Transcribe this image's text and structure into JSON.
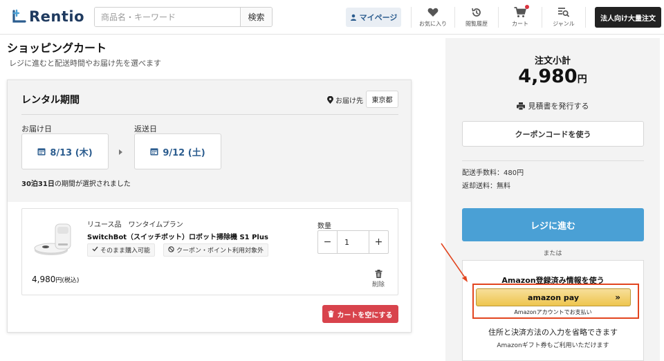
{
  "header": {
    "logo_text": "Rentio",
    "search_placeholder": "商品名・キーワード",
    "search_button": "検索",
    "mypage_label": "マイページ",
    "nav": [
      {
        "icon": "heart-icon",
        "label": "お気に入り"
      },
      {
        "icon": "history-icon",
        "label": "閲覧履歴"
      },
      {
        "icon": "cart-icon",
        "label": "カート"
      },
      {
        "icon": "genre-icon",
        "label": "ジャンル"
      }
    ],
    "corporate_button": "法人向け大量注文"
  },
  "page": {
    "title": "ショッピングカート",
    "subtitle": "レジに進むと配送時間やお届け先を選べます"
  },
  "rental": {
    "title": "レンタル期間",
    "destination_label": "お届け先",
    "destination_value": "東京都",
    "delivery_label": "お届け日",
    "delivery_date": "8/13 (木)",
    "return_label": "返送日",
    "return_date": "9/12 (土)",
    "period_bold": "30泊31日",
    "period_rest": "の期間が選択されました"
  },
  "product": {
    "condition": "リユース品　ワンタイムプラン",
    "name": "SwitchBot（スイッチボット）ロボット掃除機 S1 Plus",
    "chip_buy": "そのまま購入可能",
    "chip_coupon": "クーポン・ポイント利用対象外",
    "qty_label": "数量",
    "qty_value": "1",
    "qty_minus": "−",
    "qty_plus": "+",
    "price": "4,980",
    "price_suffix": "円(税込)",
    "delete_label": "削除"
  },
  "cart": {
    "empty_button": "カートを空にする"
  },
  "summary": {
    "title": "注文小計",
    "total": "4,980",
    "total_unit": "円",
    "estimate_label": "見積書を発行する",
    "coupon_button": "クーポンコードを使う",
    "shipping_fee": "配送手数料：480円",
    "return_fee": "返却送料：無料",
    "checkout_button": "レジに進む",
    "or_text": "または",
    "amazon_title": "Amazon登録済み情報を使う",
    "amazon_pay_label": "amazon pay",
    "amazon_chevron": "»",
    "amazon_caption": "Amazonアカウントでお支払い",
    "amazon_desc": "住所と決済方法の入力を省略できます",
    "amazon_note": "Amazonギフト券もご利用いただけます"
  },
  "colors": {
    "brand": "#1f3a5f",
    "link_blue": "#2c5d8f",
    "checkout_blue": "#4aa0d5",
    "danger_red": "#d8434c",
    "highlight_orange": "#e2451f"
  }
}
